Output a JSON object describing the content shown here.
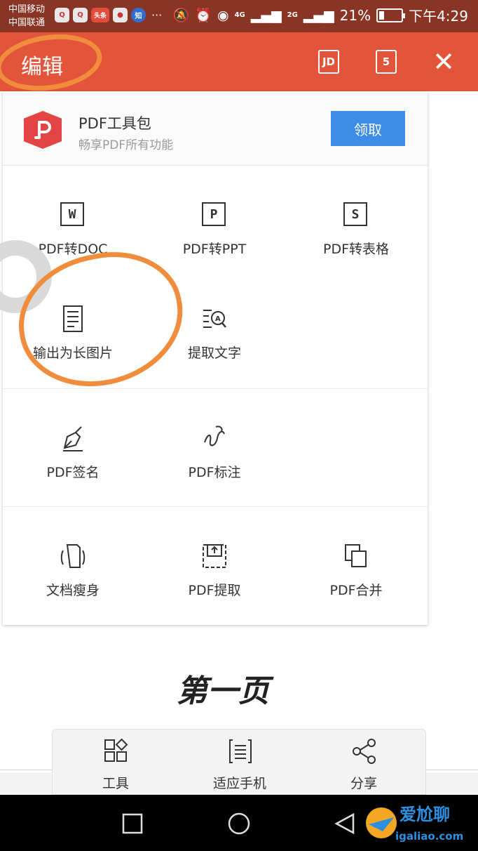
{
  "status_bar": {
    "carrier1": "中国移动",
    "carrier2": "中国联通",
    "app_icons": [
      "q-icon",
      "qq-icon",
      "toutiao-icon",
      "netease-icon",
      "zhihu-icon"
    ],
    "news_label": "头条",
    "zhihu_label": "知",
    "more": "···",
    "net1": "4G",
    "net2": "2G",
    "battery": "21%",
    "time": "下午4:29"
  },
  "app_bar": {
    "title": "编辑",
    "jd_label": "JD",
    "page_count": "5",
    "close": "✕"
  },
  "promo": {
    "title": "PDF工具包",
    "subtitle": "畅享PDF所有功能",
    "button": "领取"
  },
  "tools": {
    "to_doc": "PDF转DOC",
    "to_ppt": "PDF转PPT",
    "to_sheet": "PDF转表格",
    "long_image": "输出为长图片",
    "extract_text": "提取文字",
    "sign": "PDF签名",
    "annotate": "PDF标注",
    "slim": "文档瘦身",
    "extract": "PDF提取",
    "merge": "PDF合并",
    "icon_w": "W",
    "icon_p": "P",
    "icon_s": "S"
  },
  "page": {
    "title": "第一页"
  },
  "bottom_bar": {
    "tools": "工具",
    "fit": "适应手机",
    "share": "分享"
  },
  "watermark": {
    "text": "爱尬聊",
    "url": "igaliao.com"
  },
  "colors": {
    "accent": "#e2553a",
    "status_bar": "#8a3426",
    "button_blue": "#3e8ee9",
    "annotation": "#f08d3c"
  }
}
